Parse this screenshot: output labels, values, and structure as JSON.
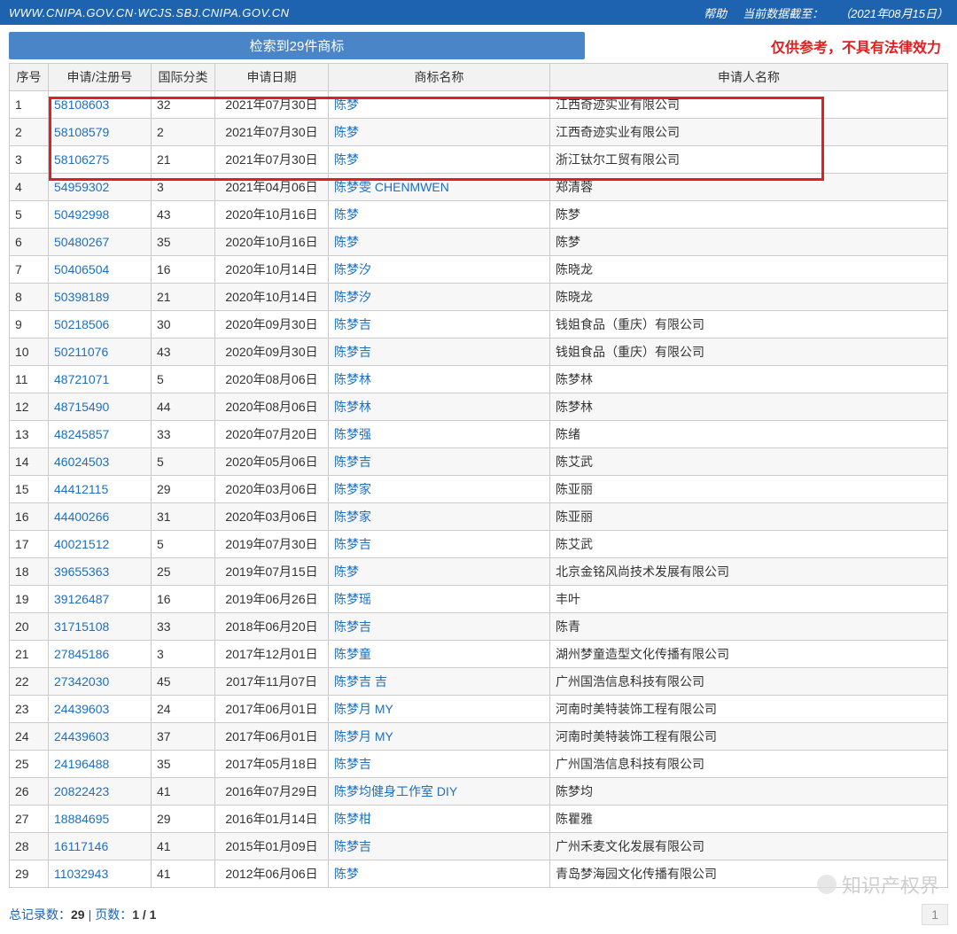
{
  "header": {
    "url": "WWW.CNIPA.GOV.CN·WCJS.SBJ.CNIPA.GOV.CN",
    "help": "帮助",
    "data_date_label": "当前数据截至：",
    "data_date": "（2021年08月15日）"
  },
  "summary": {
    "badge": "检索到29件商标",
    "disclaimer": "仅供参考，不具有法律效力"
  },
  "columns": {
    "seq": "序号",
    "reg": "申请/注册号",
    "cls": "国际分类",
    "date": "申请日期",
    "name": "商标名称",
    "applicant": "申请人名称"
  },
  "rows": [
    {
      "seq": "1",
      "reg": "58108603",
      "cls": "32",
      "date": "2021年07月30日",
      "name": "陈梦",
      "applicant": "江西奇迹实业有限公司"
    },
    {
      "seq": "2",
      "reg": "58108579",
      "cls": "2",
      "date": "2021年07月30日",
      "name": "陈梦",
      "applicant": "江西奇迹实业有限公司"
    },
    {
      "seq": "3",
      "reg": "58106275",
      "cls": "21",
      "date": "2021年07月30日",
      "name": "陈梦",
      "applicant": "浙江钛尔工贸有限公司"
    },
    {
      "seq": "4",
      "reg": "54959302",
      "cls": "3",
      "date": "2021年04月06日",
      "name": "陈梦雯 CHENMWEN",
      "applicant": "郑清蓉"
    },
    {
      "seq": "5",
      "reg": "50492998",
      "cls": "43",
      "date": "2020年10月16日",
      "name": "陈梦",
      "applicant": "陈梦"
    },
    {
      "seq": "6",
      "reg": "50480267",
      "cls": "35",
      "date": "2020年10月16日",
      "name": "陈梦",
      "applicant": "陈梦"
    },
    {
      "seq": "7",
      "reg": "50406504",
      "cls": "16",
      "date": "2020年10月14日",
      "name": "陈梦汐",
      "applicant": "陈晓龙"
    },
    {
      "seq": "8",
      "reg": "50398189",
      "cls": "21",
      "date": "2020年10月14日",
      "name": "陈梦汐",
      "applicant": "陈晓龙"
    },
    {
      "seq": "9",
      "reg": "50218506",
      "cls": "30",
      "date": "2020年09月30日",
      "name": "陈梦吉",
      "applicant": "钱姐食品（重庆）有限公司"
    },
    {
      "seq": "10",
      "reg": "50211076",
      "cls": "43",
      "date": "2020年09月30日",
      "name": "陈梦吉",
      "applicant": "钱姐食品（重庆）有限公司"
    },
    {
      "seq": "11",
      "reg": "48721071",
      "cls": "5",
      "date": "2020年08月06日",
      "name": "陈梦林",
      "applicant": "陈梦林"
    },
    {
      "seq": "12",
      "reg": "48715490",
      "cls": "44",
      "date": "2020年08月06日",
      "name": "陈梦林",
      "applicant": "陈梦林"
    },
    {
      "seq": "13",
      "reg": "48245857",
      "cls": "33",
      "date": "2020年07月20日",
      "name": "陈梦强",
      "applicant": "陈绪"
    },
    {
      "seq": "14",
      "reg": "46024503",
      "cls": "5",
      "date": "2020年05月06日",
      "name": "陈梦吉",
      "applicant": "陈艾武"
    },
    {
      "seq": "15",
      "reg": "44412115",
      "cls": "29",
      "date": "2020年03月06日",
      "name": "陈梦家",
      "applicant": "陈亚丽"
    },
    {
      "seq": "16",
      "reg": "44400266",
      "cls": "31",
      "date": "2020年03月06日",
      "name": "陈梦家",
      "applicant": "陈亚丽"
    },
    {
      "seq": "17",
      "reg": "40021512",
      "cls": "5",
      "date": "2019年07月30日",
      "name": "陈梦吉",
      "applicant": "陈艾武"
    },
    {
      "seq": "18",
      "reg": "39655363",
      "cls": "25",
      "date": "2019年07月15日",
      "name": "陈梦",
      "applicant": "北京金铭风尚技术发展有限公司"
    },
    {
      "seq": "19",
      "reg": "39126487",
      "cls": "16",
      "date": "2019年06月26日",
      "name": "陈梦瑶",
      "applicant": "丰叶"
    },
    {
      "seq": "20",
      "reg": "31715108",
      "cls": "33",
      "date": "2018年06月20日",
      "name": "陈梦吉",
      "applicant": "陈青"
    },
    {
      "seq": "21",
      "reg": "27845186",
      "cls": "3",
      "date": "2017年12月01日",
      "name": "陈梦童",
      "applicant": "湖州梦童造型文化传播有限公司"
    },
    {
      "seq": "22",
      "reg": "27342030",
      "cls": "45",
      "date": "2017年11月07日",
      "name": "陈梦吉 吉",
      "applicant": "广州国浩信息科技有限公司"
    },
    {
      "seq": "23",
      "reg": "24439603",
      "cls": "24",
      "date": "2017年06月01日",
      "name": "陈梦月 MY",
      "applicant": "河南时美特装饰工程有限公司"
    },
    {
      "seq": "24",
      "reg": "24439603",
      "cls": "37",
      "date": "2017年06月01日",
      "name": "陈梦月 MY",
      "applicant": "河南时美特装饰工程有限公司"
    },
    {
      "seq": "25",
      "reg": "24196488",
      "cls": "35",
      "date": "2017年05月18日",
      "name": "陈梦吉",
      "applicant": "广州国浩信息科技有限公司"
    },
    {
      "seq": "26",
      "reg": "20822423",
      "cls": "41",
      "date": "2016年07月29日",
      "name": "陈梦均健身工作室 DIY",
      "applicant": "陈梦均"
    },
    {
      "seq": "27",
      "reg": "18884695",
      "cls": "29",
      "date": "2016年01月14日",
      "name": "陈梦柑",
      "applicant": "陈瞿雅"
    },
    {
      "seq": "28",
      "reg": "16117146",
      "cls": "41",
      "date": "2015年01月09日",
      "name": "陈梦吉",
      "applicant": "广州禾麦文化发展有限公司"
    },
    {
      "seq": "29",
      "reg": "11032943",
      "cls": "41",
      "date": "2012年06月06日",
      "name": "陈梦",
      "applicant": "青岛梦海园文化传播有限公司"
    }
  ],
  "footer": {
    "total_label": "总记录数：",
    "total": "29",
    "pages_label": "页数：",
    "pages": "1 / 1",
    "current_page": "1"
  },
  "watermark": "知识产权界"
}
